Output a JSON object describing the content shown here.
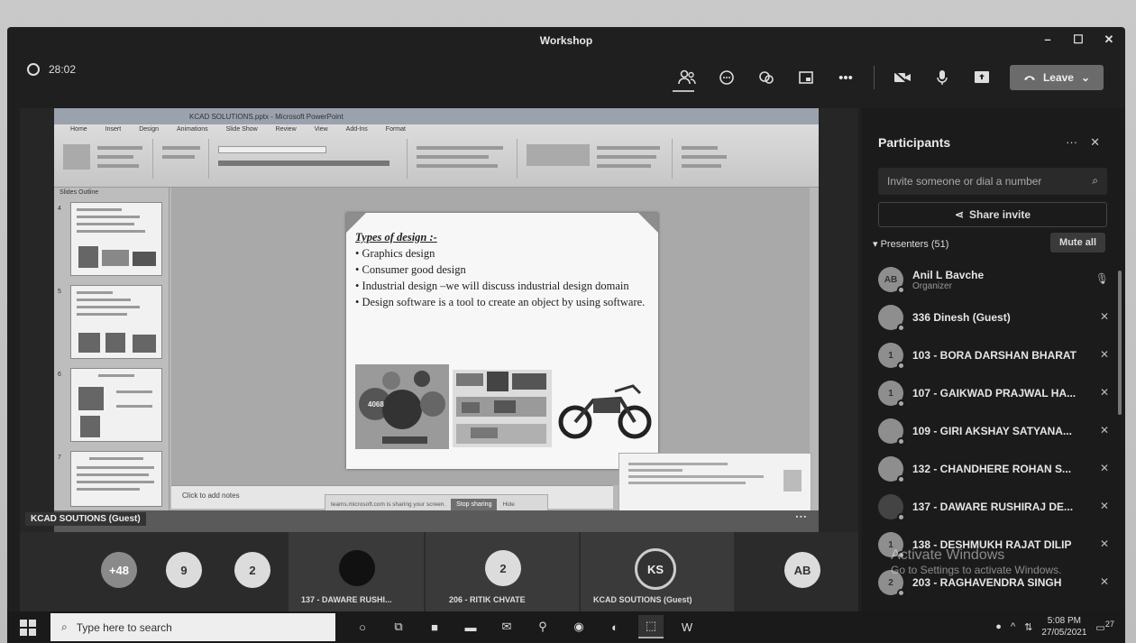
{
  "window": {
    "title": "Workshop",
    "minimize": "–",
    "maximize": "☐",
    "close": "✕"
  },
  "meeting": {
    "timer": "28:02",
    "leave_label": "Leave",
    "icons": [
      "participants-icon",
      "chat-icon",
      "reactions-icon",
      "rooms-icon",
      "more-icon",
      "camera-off-icon",
      "mic-icon",
      "share-tray-icon"
    ]
  },
  "ppt": {
    "title_bar": "KCAD SOLUTIONS.pptx - Microsoft PowerPoint",
    "tabs": [
      "Home",
      "Insert",
      "Design",
      "Animations",
      "Slide Show",
      "Review",
      "View",
      "Add-Ins",
      "Format"
    ],
    "panel_tabs": "Slides   Outline",
    "notes_placeholder": "Click to add notes",
    "slide": {
      "heading": "Types of design :-",
      "bullets": [
        "• Graphics design",
        "• Consumer good design",
        "• Industrial design –we will discuss industrial design domain",
        "• Design software is a tool to create an object by using   software."
      ]
    },
    "sharing_text": "teams.microsoft.com is sharing your screen.",
    "stop_sharing": "Stop sharing",
    "hide": "Hide",
    "presenter_tag": "KCAD SOUTIONS (Guest)"
  },
  "participants": {
    "title": "Participants",
    "invite_placeholder": "Invite someone or dial a number",
    "share_invite": "Share invite",
    "presenters_label": "▾ Presenters (51)",
    "mute_all": "Mute all",
    "list": [
      {
        "initials": "AB",
        "name": "Anil L Bavche",
        "sub": "Organizer"
      },
      {
        "initials": "",
        "name": "336 Dinesh (Guest)",
        "sub": ""
      },
      {
        "initials": "1",
        "name": "103 - BORA DARSHAN BHARAT",
        "sub": ""
      },
      {
        "initials": "1",
        "name": "107 - GAIKWAD PRAJWAL HA...",
        "sub": ""
      },
      {
        "initials": "",
        "name": "109 - GIRI AKSHAY SATYANA...",
        "sub": ""
      },
      {
        "initials": "",
        "name": "132 - CHANDHERE ROHAN S...",
        "sub": ""
      },
      {
        "initials": "",
        "name": "137 - DAWARE RUSHIRAJ DE...",
        "sub": ""
      },
      {
        "initials": "1",
        "name": "138 - DESHMUKH RAJAT DILIP",
        "sub": ""
      },
      {
        "initials": "2",
        "name": "203 - RAGHAVENDRA SINGH",
        "sub": ""
      }
    ]
  },
  "gallery": {
    "tiles": [
      {
        "text": "+48"
      },
      {
        "text": "9"
      },
      {
        "text": "2"
      },
      {
        "text": "",
        "label": "137 - DAWARE RUSHI..."
      },
      {
        "text": "2",
        "label": "206 - RITIK CHVATE"
      },
      {
        "text": "KS",
        "label": "KCAD SOUTIONS (Guest)"
      },
      {
        "text": "AB"
      }
    ]
  },
  "watermark": {
    "line1": "Activate Windows",
    "line2": "Go to Settings to activate Windows."
  },
  "taskbar": {
    "search_placeholder": "Type here to search",
    "time": "5:08 PM",
    "date": "27/05/2021",
    "notif_count": "27"
  }
}
